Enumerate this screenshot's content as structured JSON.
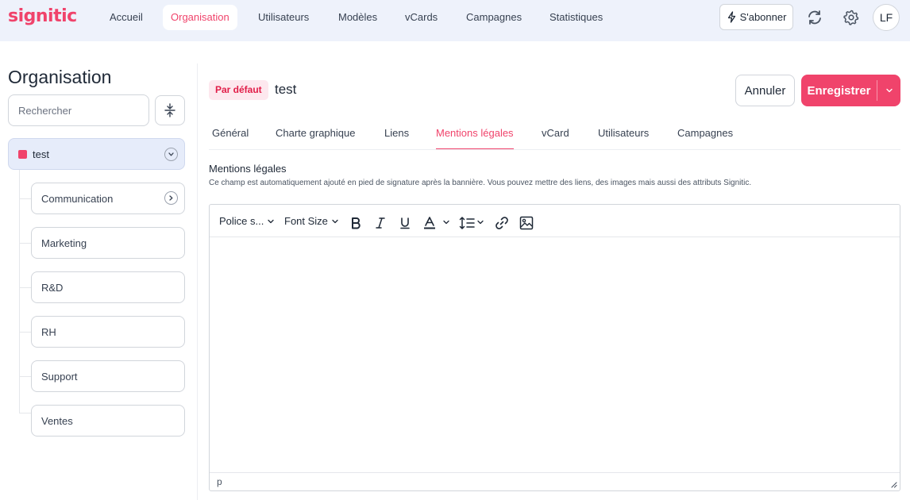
{
  "logo": "signitic",
  "nav": {
    "items": [
      {
        "label": "Accueil"
      },
      {
        "label": "Organisation"
      },
      {
        "label": "Utilisateurs"
      },
      {
        "label": "Modèles"
      },
      {
        "label": "vCards"
      },
      {
        "label": "Campagnes"
      },
      {
        "label": "Statistiques"
      }
    ],
    "active": "Organisation",
    "subscribe_label": "S'abonner",
    "avatar_initials": "LF"
  },
  "sidebar": {
    "title": "Organisation",
    "search_placeholder": "Rechercher",
    "root": {
      "label": "test",
      "color": "#f0436b"
    },
    "children": [
      {
        "label": "Communication",
        "has_children": true
      },
      {
        "label": "Marketing"
      },
      {
        "label": "R&D"
      },
      {
        "label": "RH"
      },
      {
        "label": "Support"
      },
      {
        "label": "Ventes"
      }
    ]
  },
  "header": {
    "badge": "Par défaut",
    "name": "test",
    "cancel_label": "Annuler",
    "save_label": "Enregistrer"
  },
  "tabs": [
    {
      "label": "Général"
    },
    {
      "label": "Charte graphique"
    },
    {
      "label": "Liens"
    },
    {
      "label": "Mentions légales"
    },
    {
      "label": "vCard"
    },
    {
      "label": "Utilisateurs"
    },
    {
      "label": "Campagnes"
    }
  ],
  "active_tab": "Mentions légales",
  "section": {
    "title": "Mentions légales",
    "description": "Ce champ est automatiquement ajouté en pied de signature après la bannière. Vous pouvez mettre des liens, des images mais aussi des attributs Signitic."
  },
  "editor": {
    "font_family": "Police s...",
    "font_size": "Font Size",
    "status_path": "p",
    "icons": [
      "bold-icon",
      "italic-icon",
      "underline-icon",
      "text-color-icon",
      "line-height-icon",
      "link-icon",
      "image-icon"
    ]
  },
  "colors": {
    "accent": "#f0436b",
    "topbar_bg": "#eef2fb",
    "badge_bg": "#fde8ee"
  }
}
